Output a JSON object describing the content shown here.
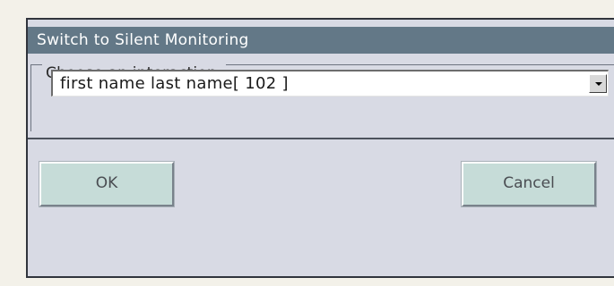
{
  "dialog": {
    "title": "Switch to Silent Monitoring",
    "legend": "Choose an interaction:",
    "interaction_select": {
      "selected_value": "first name last name[ 102 ]",
      "arrow_icon": "dropdown-arrow-icon"
    },
    "ok_label": "OK",
    "cancel_label": "Cancel"
  },
  "colors": {
    "titlebar": "#637887",
    "dialog_background": "#d8dae4",
    "button_face": "#c6dcd8",
    "page_background": "#f3f1e9"
  }
}
